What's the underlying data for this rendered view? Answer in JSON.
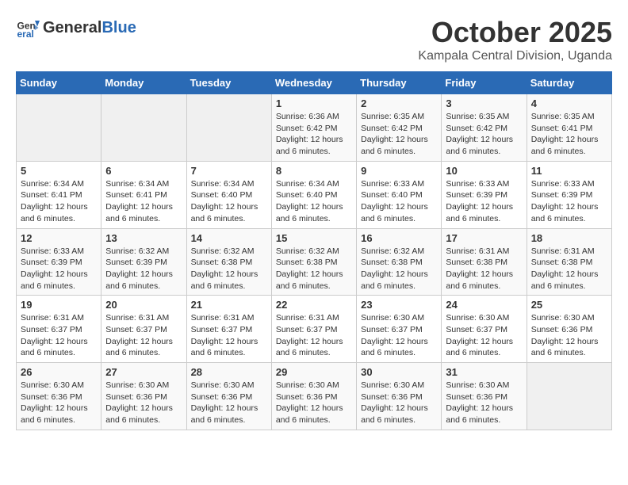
{
  "header": {
    "logo_general": "General",
    "logo_blue": "Blue",
    "month": "October 2025",
    "location": "Kampala Central Division, Uganda"
  },
  "days_of_week": [
    "Sunday",
    "Monday",
    "Tuesday",
    "Wednesday",
    "Thursday",
    "Friday",
    "Saturday"
  ],
  "weeks": [
    [
      {
        "day": "",
        "info": ""
      },
      {
        "day": "",
        "info": ""
      },
      {
        "day": "",
        "info": ""
      },
      {
        "day": "1",
        "info": "Sunrise: 6:36 AM\nSunset: 6:42 PM\nDaylight: 12 hours and 6 minutes."
      },
      {
        "day": "2",
        "info": "Sunrise: 6:35 AM\nSunset: 6:42 PM\nDaylight: 12 hours and 6 minutes."
      },
      {
        "day": "3",
        "info": "Sunrise: 6:35 AM\nSunset: 6:42 PM\nDaylight: 12 hours and 6 minutes."
      },
      {
        "day": "4",
        "info": "Sunrise: 6:35 AM\nSunset: 6:41 PM\nDaylight: 12 hours and 6 minutes."
      }
    ],
    [
      {
        "day": "5",
        "info": "Sunrise: 6:34 AM\nSunset: 6:41 PM\nDaylight: 12 hours and 6 minutes."
      },
      {
        "day": "6",
        "info": "Sunrise: 6:34 AM\nSunset: 6:41 PM\nDaylight: 12 hours and 6 minutes."
      },
      {
        "day": "7",
        "info": "Sunrise: 6:34 AM\nSunset: 6:40 PM\nDaylight: 12 hours and 6 minutes."
      },
      {
        "day": "8",
        "info": "Sunrise: 6:34 AM\nSunset: 6:40 PM\nDaylight: 12 hours and 6 minutes."
      },
      {
        "day": "9",
        "info": "Sunrise: 6:33 AM\nSunset: 6:40 PM\nDaylight: 12 hours and 6 minutes."
      },
      {
        "day": "10",
        "info": "Sunrise: 6:33 AM\nSunset: 6:39 PM\nDaylight: 12 hours and 6 minutes."
      },
      {
        "day": "11",
        "info": "Sunrise: 6:33 AM\nSunset: 6:39 PM\nDaylight: 12 hours and 6 minutes."
      }
    ],
    [
      {
        "day": "12",
        "info": "Sunrise: 6:33 AM\nSunset: 6:39 PM\nDaylight: 12 hours and 6 minutes."
      },
      {
        "day": "13",
        "info": "Sunrise: 6:32 AM\nSunset: 6:39 PM\nDaylight: 12 hours and 6 minutes."
      },
      {
        "day": "14",
        "info": "Sunrise: 6:32 AM\nSunset: 6:38 PM\nDaylight: 12 hours and 6 minutes."
      },
      {
        "day": "15",
        "info": "Sunrise: 6:32 AM\nSunset: 6:38 PM\nDaylight: 12 hours and 6 minutes."
      },
      {
        "day": "16",
        "info": "Sunrise: 6:32 AM\nSunset: 6:38 PM\nDaylight: 12 hours and 6 minutes."
      },
      {
        "day": "17",
        "info": "Sunrise: 6:31 AM\nSunset: 6:38 PM\nDaylight: 12 hours and 6 minutes."
      },
      {
        "day": "18",
        "info": "Sunrise: 6:31 AM\nSunset: 6:38 PM\nDaylight: 12 hours and 6 minutes."
      }
    ],
    [
      {
        "day": "19",
        "info": "Sunrise: 6:31 AM\nSunset: 6:37 PM\nDaylight: 12 hours and 6 minutes."
      },
      {
        "day": "20",
        "info": "Sunrise: 6:31 AM\nSunset: 6:37 PM\nDaylight: 12 hours and 6 minutes."
      },
      {
        "day": "21",
        "info": "Sunrise: 6:31 AM\nSunset: 6:37 PM\nDaylight: 12 hours and 6 minutes."
      },
      {
        "day": "22",
        "info": "Sunrise: 6:31 AM\nSunset: 6:37 PM\nDaylight: 12 hours and 6 minutes."
      },
      {
        "day": "23",
        "info": "Sunrise: 6:30 AM\nSunset: 6:37 PM\nDaylight: 12 hours and 6 minutes."
      },
      {
        "day": "24",
        "info": "Sunrise: 6:30 AM\nSunset: 6:37 PM\nDaylight: 12 hours and 6 minutes."
      },
      {
        "day": "25",
        "info": "Sunrise: 6:30 AM\nSunset: 6:36 PM\nDaylight: 12 hours and 6 minutes."
      }
    ],
    [
      {
        "day": "26",
        "info": "Sunrise: 6:30 AM\nSunset: 6:36 PM\nDaylight: 12 hours and 6 minutes."
      },
      {
        "day": "27",
        "info": "Sunrise: 6:30 AM\nSunset: 6:36 PM\nDaylight: 12 hours and 6 minutes."
      },
      {
        "day": "28",
        "info": "Sunrise: 6:30 AM\nSunset: 6:36 PM\nDaylight: 12 hours and 6 minutes."
      },
      {
        "day": "29",
        "info": "Sunrise: 6:30 AM\nSunset: 6:36 PM\nDaylight: 12 hours and 6 minutes."
      },
      {
        "day": "30",
        "info": "Sunrise: 6:30 AM\nSunset: 6:36 PM\nDaylight: 12 hours and 6 minutes."
      },
      {
        "day": "31",
        "info": "Sunrise: 6:30 AM\nSunset: 6:36 PM\nDaylight: 12 hours and 6 minutes."
      },
      {
        "day": "",
        "info": ""
      }
    ]
  ]
}
